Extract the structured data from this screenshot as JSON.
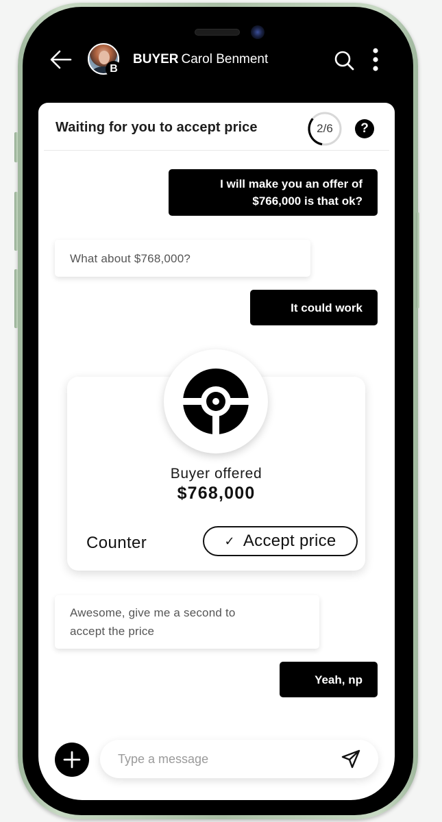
{
  "header": {
    "back_icon": "arrow-left-icon",
    "contact": {
      "role": "BUYER",
      "name": "Carol Benment",
      "avatar_badge": "B"
    },
    "search_icon": "search-icon",
    "more_icon": "more-vertical-icon"
  },
  "status": {
    "text": "Waiting for you to accept price",
    "step_label": "2/6",
    "step_current": 2,
    "step_total": 6,
    "help_label": "?"
  },
  "messages": [
    {
      "direction": "outgoing",
      "lines": [
        "I will make you an offer of",
        "$766,000 is that ok?"
      ]
    },
    {
      "direction": "incoming",
      "text": "What about $768,000?"
    },
    {
      "direction": "outgoing",
      "text": "It could work"
    },
    {
      "direction": "incoming",
      "lines": [
        "Awesome, give me a second to",
        "accept the price"
      ]
    },
    {
      "direction": "outgoing",
      "text": "Yeah, np"
    }
  ],
  "offer_card": {
    "icon": "offer-emblem-icon",
    "label": "Buyer offered",
    "amount": "$768,000",
    "counter_label": "Counter",
    "accept_check": "✓",
    "accept_label": "Accept price"
  },
  "composer": {
    "add_icon": "plus-icon",
    "placeholder": "Type a message",
    "value": "",
    "send_icon": "send-icon"
  },
  "colors": {
    "primary": "#000000",
    "surface": "#ffffff",
    "frame": "#b5cbb1",
    "progress_track": "#d8d8d8"
  }
}
